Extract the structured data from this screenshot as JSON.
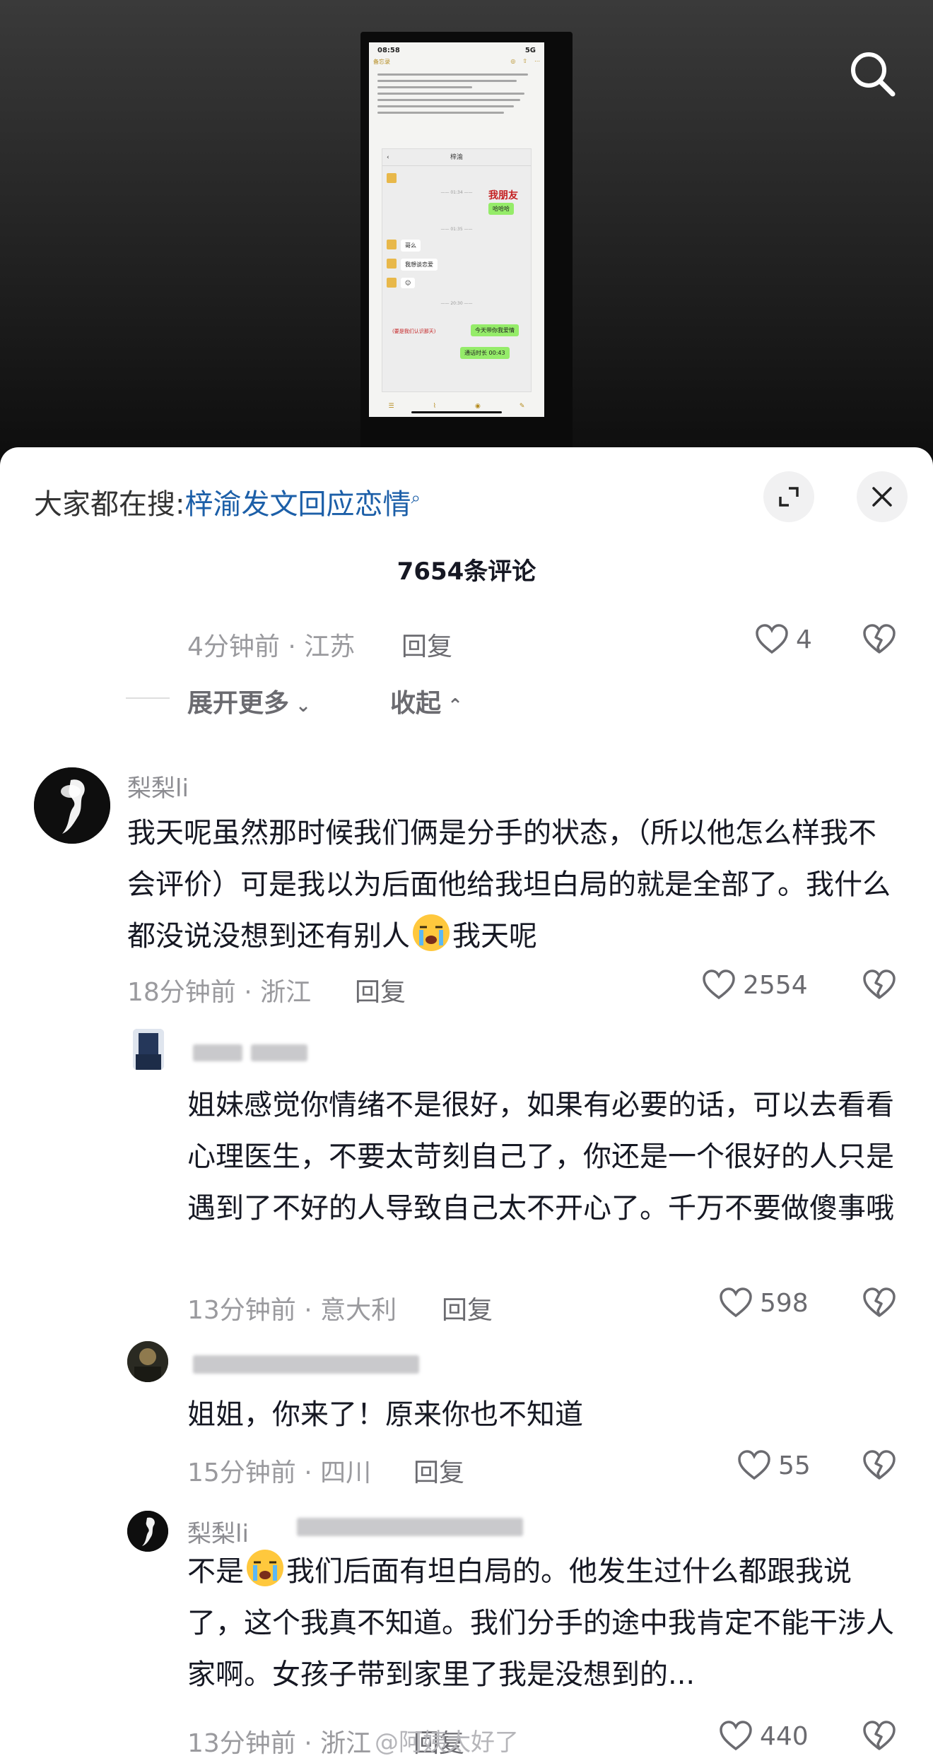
{
  "video": {
    "phone_time": "08:58",
    "phone_signal": "5G",
    "notes_back": "备忘录",
    "chat_title": "梓渝",
    "my_friend_label": "我朋友",
    "chat_lines": [
      "哈哈哈",
      "哥么",
      "我想谈恋爱",
      "今天带你我爱情",
      "通话时长 00:43"
    ],
    "red_caption": "(要是我们认识那天)",
    "search_icon": "search-icon"
  },
  "sheet": {
    "hot_search_label": "大家都在搜:",
    "hot_search_keyword": "梓渝发文回应恋情",
    "comment_count": "7654条评论"
  },
  "prev_comment": {
    "meta": "4分钟前 · 江苏",
    "reply": "回复",
    "likes": "4"
  },
  "thread_controls": {
    "expand_more": "展开更多",
    "collapse": "收起"
  },
  "comments": [
    {
      "username": "梨梨li",
      "text_before_emoji": "我天呢虽然那时候我们俩是分手的状态，（所以他怎么样我不会评价）可是我以为后面他给我坦白局的就是全部了。我什么都没说没想到还有别人",
      "text_after_emoji": "我天呢",
      "meta": "18分钟前 · 浙江",
      "reply": "回复",
      "likes": "2554"
    }
  ],
  "replies": [
    {
      "text": "姐妹感觉你情绪不是很好，如果有必要的话，可以去看看心理医生，不要太苛刻自己了，你还是一个很好的人只是遇到了不好的人导致自己太不开心了。千万不要做傻事哦",
      "meta": "13分钟前 · 意大利",
      "reply": "回复",
      "likes": "598"
    },
    {
      "text": "姐姐，你来了！原来你也不知道",
      "meta": "15分钟前 · 四川",
      "reply": "回复",
      "likes": "55"
    },
    {
      "username": "梨梨li",
      "text_before_emoji": "不是",
      "text_after_emoji": "我们后面有坦白局的。他发生过什么都跟我说了，这个我真不知道。我们分手的途中我肯定不能干涉人家啊。女孩子带到家里了我是没想到的...",
      "meta": "13分钟前 · 浙江",
      "reply": "回复",
      "likes": "440"
    }
  ],
  "watermark": "@阿姨太好了",
  "colors": {
    "keyword_blue": "#1c5fa8",
    "meta_gray": "#9a9a9e",
    "text": "#161823"
  }
}
